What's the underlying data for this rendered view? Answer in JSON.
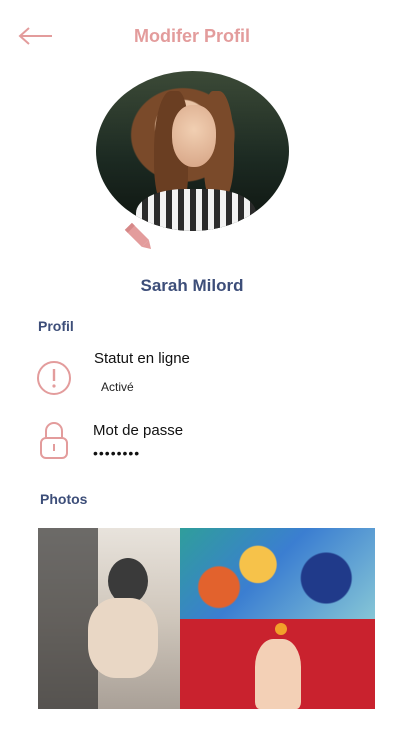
{
  "header": {
    "title": "Modifer Profil",
    "back_icon": "arrow-left-icon"
  },
  "profile": {
    "name": "Sarah Milord",
    "edit_icon": "pencil-icon"
  },
  "sections": {
    "profil": "Profil",
    "photos": "Photos"
  },
  "rows": {
    "status": {
      "title": "Statut en ligne",
      "value": "Activé",
      "icon": "alert-circle-icon"
    },
    "password": {
      "title": "Mot de passe",
      "value": "••••••••",
      "icon": "lock-icon"
    }
  },
  "colors": {
    "accent": "#E39C9C",
    "name_blue": "#3D4E79",
    "photo_red": "#C9222E"
  }
}
